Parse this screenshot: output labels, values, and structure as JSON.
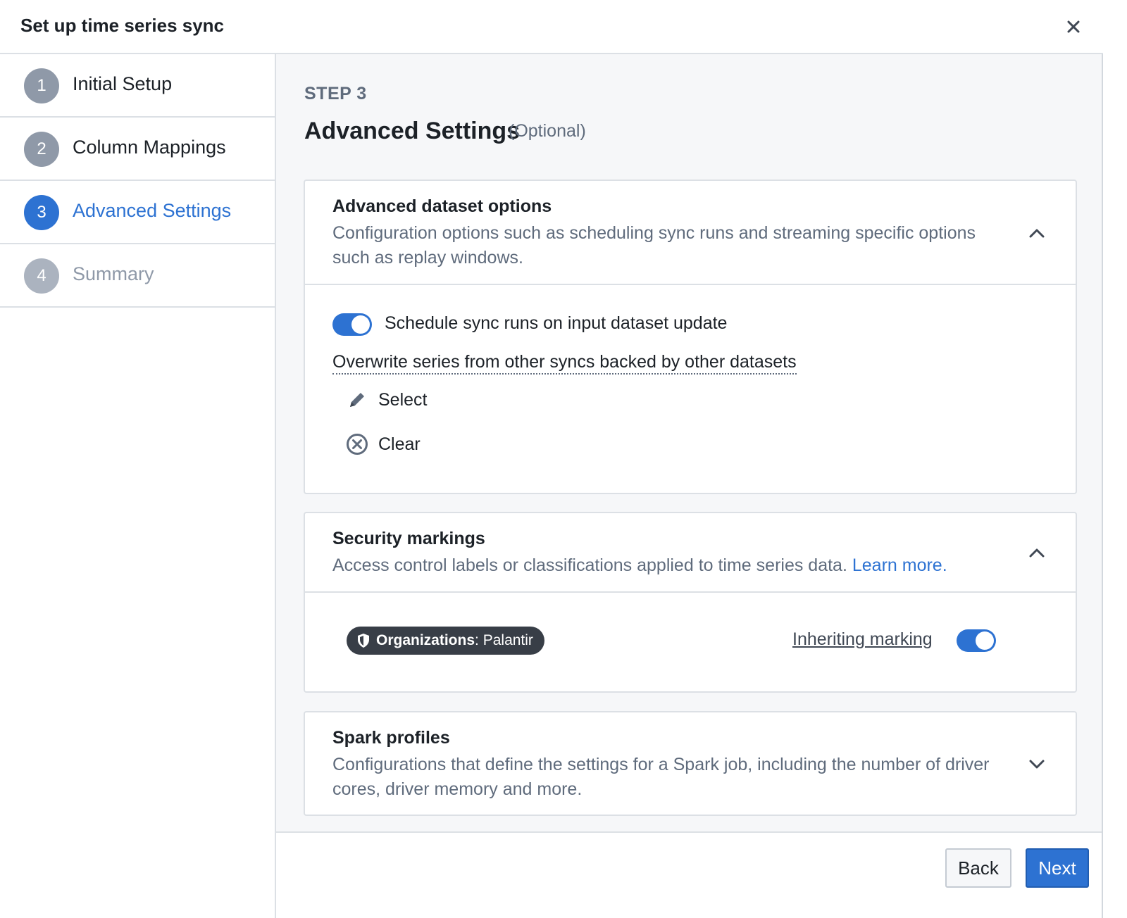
{
  "dialog": {
    "title": "Set up time series sync",
    "close_icon": "close-icon"
  },
  "steps": [
    {
      "number": "1",
      "label": "Initial Setup",
      "state": "done"
    },
    {
      "number": "2",
      "label": "Column Mappings",
      "state": "done"
    },
    {
      "number": "3",
      "label": "Advanced Settings",
      "state": "active"
    },
    {
      "number": "4",
      "label": "Summary",
      "state": "disabled"
    }
  ],
  "main": {
    "kicker": "STEP 3",
    "title": "Advanced Settings",
    "optional": "(Optional)"
  },
  "advanced_dataset": {
    "title": "Advanced dataset options",
    "description": "Configuration options such as scheduling sync runs and streaming specific options such as replay windows.",
    "schedule_toggle_label": "Schedule sync runs on input dataset update",
    "schedule_toggle_on": true,
    "overwrite_label": "Overwrite series from other syncs backed by other datasets",
    "select_label": "Select",
    "clear_label": "Clear",
    "expanded": true
  },
  "security": {
    "title": "Security markings",
    "description": "Access control labels or classifications applied to time series data.",
    "learn_more": "Learn more.",
    "marking_key": "Organizations",
    "marking_sep": ":",
    "marking_value": "Palantir",
    "inheriting_label": "Inheriting marking",
    "inheriting_on": true,
    "expanded": true
  },
  "spark": {
    "title": "Spark profiles",
    "description": "Configurations that define the settings for a Spark job, including the number of driver cores, driver memory and more.",
    "expanded": false
  },
  "footer": {
    "back_label": "Back",
    "next_label": "Next"
  },
  "colors": {
    "accent": "#2d72d2",
    "muted": "#5f6b7c",
    "tag_bg": "#383e47"
  }
}
